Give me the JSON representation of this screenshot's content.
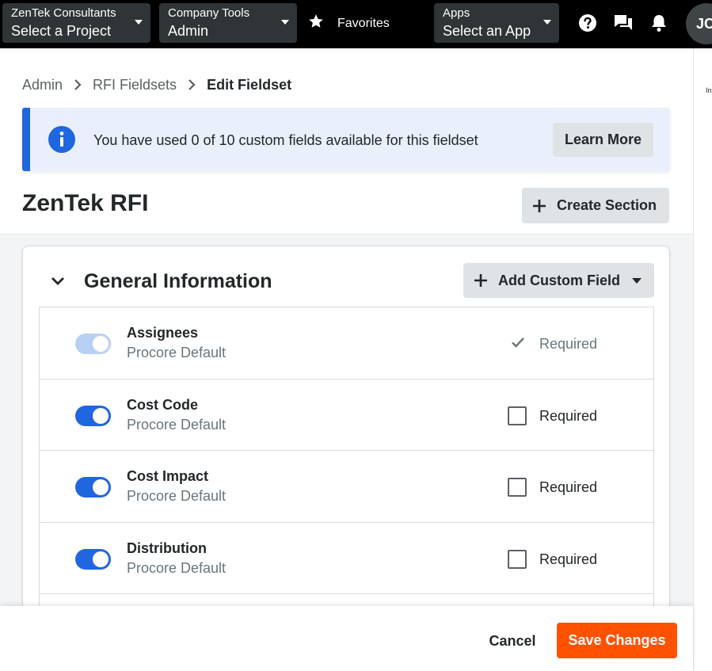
{
  "topnav": {
    "project": {
      "small": "ZenTek Consultants",
      "big": "Select a Project"
    },
    "tools": {
      "small": "Company Tools",
      "big": "Admin"
    },
    "favorites_label": "Favorites",
    "apps": {
      "small": "Apps",
      "big": "Select an App"
    },
    "avatar_initials": "JC"
  },
  "side_strip_text": "In",
  "breadcrumb": {
    "items": [
      "Admin",
      "RFI Fieldsets"
    ],
    "current": "Edit Fieldset"
  },
  "banner": {
    "message": "You have used 0 of 10 custom fields available for this fieldset",
    "button": "Learn More",
    "accent_color": "#2066df"
  },
  "page": {
    "title": "ZenTek RFI",
    "create_section_label": "Create Section"
  },
  "section": {
    "title": "General Information",
    "add_field_label": "Add Custom Field",
    "fields": [
      {
        "name": "Assignees",
        "source": "Procore Default",
        "enabled": true,
        "locked": true,
        "required": true,
        "required_label": "Required"
      },
      {
        "name": "Cost Code",
        "source": "Procore Default",
        "enabled": true,
        "locked": false,
        "required": false,
        "required_label": "Required"
      },
      {
        "name": "Cost Impact",
        "source": "Procore Default",
        "enabled": true,
        "locked": false,
        "required": false,
        "required_label": "Required"
      },
      {
        "name": "Distribution",
        "source": "Procore Default",
        "enabled": true,
        "locked": false,
        "required": false,
        "required_label": "Required"
      }
    ]
  },
  "footer": {
    "cancel": "Cancel",
    "save": "Save Changes",
    "save_color": "#ff5200"
  }
}
